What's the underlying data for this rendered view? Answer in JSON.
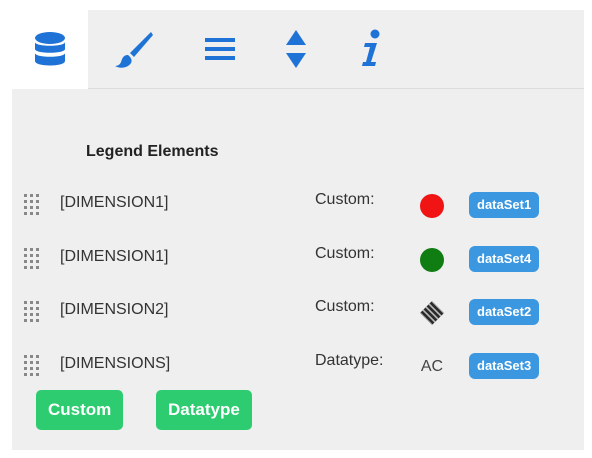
{
  "tabs": [
    {
      "icon": "database-icon",
      "active": true
    },
    {
      "icon": "brush-icon",
      "active": false
    },
    {
      "icon": "list-icon",
      "active": false
    },
    {
      "icon": "sort-icon",
      "active": false
    },
    {
      "icon": "info-icon",
      "active": false
    }
  ],
  "colors": {
    "tab_icon": "#1f73d6",
    "badge": "#3a97e0",
    "green_button": "#2ecc71",
    "panel_bg": "#efefef"
  },
  "legend": {
    "title": "Legend Elements",
    "rows": [
      {
        "dimension": "[DIMENSION1]",
        "type": "Custom:",
        "marker": "red-dot",
        "marker_color": "#f01414",
        "dataset": "dataSet1"
      },
      {
        "dimension": "[DIMENSION1]",
        "type": "Custom:",
        "marker": "green-dot",
        "marker_color": "#0f7d12",
        "dataset": "dataSet4"
      },
      {
        "dimension": "[DIMENSION2]",
        "type": "Custom:",
        "marker": "pattern-diamond-icon",
        "marker_color": "#333333",
        "dataset": "dataSet2"
      },
      {
        "dimension": "[DIMENSIONS]",
        "type": "Datatype:",
        "marker": "text",
        "marker_text": "AC",
        "dataset": "dataSet3"
      }
    ]
  },
  "buttons": {
    "custom_label": "Custom",
    "datatype_label": "Datatype"
  }
}
